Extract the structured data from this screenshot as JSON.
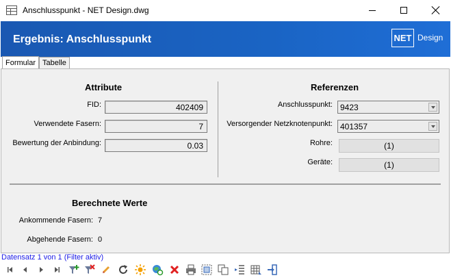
{
  "window": {
    "title": "Anschlusspunkt - NET Design.dwg",
    "minimize_icon": "minimize-icon",
    "maximize_icon": "maximize-icon",
    "close_icon": "close-icon"
  },
  "header": {
    "title": "Ergebnis: Anschlusspunkt",
    "logo_box": "NET",
    "logo_text": "Design"
  },
  "tabs": [
    {
      "label": "Formular",
      "active": true
    },
    {
      "label": "Tabelle",
      "active": false
    }
  ],
  "attribute": {
    "title": "Attribute",
    "fields": [
      {
        "label": "FID:",
        "value": "402409"
      },
      {
        "label": "Verwendete Fasern:",
        "value": "7"
      },
      {
        "label": "Bewertung der Anbindung:",
        "value": "0.03"
      }
    ]
  },
  "referenzen": {
    "title": "Referenzen",
    "anschlusspunkt": {
      "label": "Anschlusspunkt:",
      "value": "9423"
    },
    "versorgender": {
      "label": "Versorgender Netzknotenpunkt:",
      "value": "401357"
    },
    "rohre": {
      "label": "Rohre:",
      "value": "(1)"
    },
    "geraete": {
      "label": "Geräte:",
      "value": "(1)"
    }
  },
  "berechnete": {
    "title": "Berechnete Werte",
    "ankommende": {
      "label": "Ankommende Fasern:",
      "value": "7"
    },
    "abgehende": {
      "label": "Abgehende Fasern:",
      "value": "0"
    }
  },
  "status": {
    "text": "Datensatz 1 von 1 (Filter aktiv)"
  },
  "toolbar": {
    "icons": [
      "first-record-icon",
      "previous-record-icon",
      "next-record-icon",
      "last-record-icon",
      "add-filter-icon",
      "remove-filter-icon",
      "edit-icon",
      "refresh-icon",
      "highlight-icon",
      "zoom-to-icon",
      "delete-icon",
      "print-icon",
      "select-icon",
      "copy-icon",
      "compare-icon",
      "table-icon",
      "exit-icon"
    ]
  },
  "colors": {
    "header_blue": "#1a64c4",
    "status_blue": "#1a1ae6",
    "delete_red": "#e02020"
  }
}
